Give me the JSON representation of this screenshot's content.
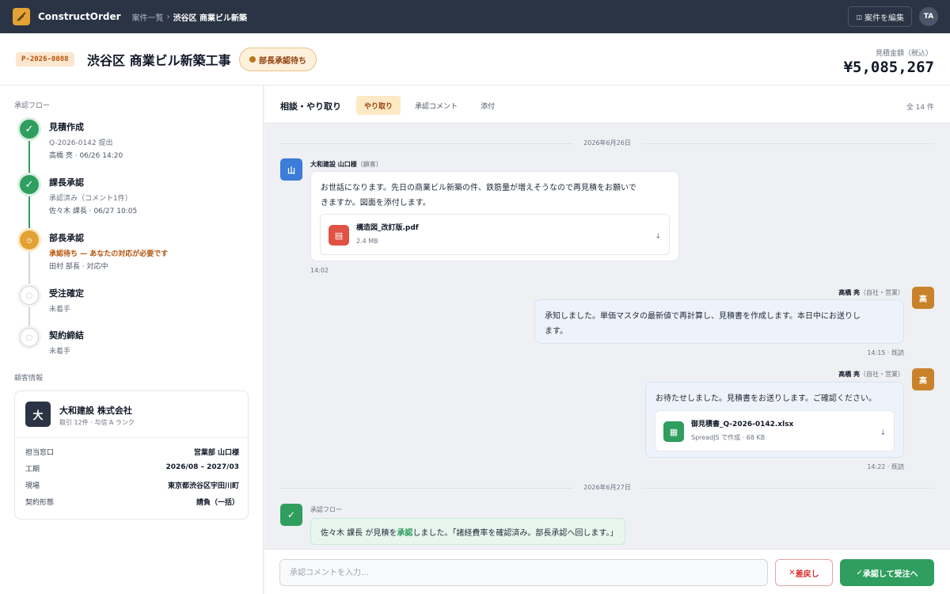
{
  "topbar": {
    "app_title": "ConstructOrder",
    "breadcrumb_parent": "案件一覧",
    "breadcrumb_sep": "›",
    "breadcrumb_current": "渋谷区 商業ビル新築",
    "edit_label": "案件を編集",
    "user_initials": "TA"
  },
  "header": {
    "project_id": "P-2026-0088",
    "title": "渋谷区 商業ビル新築工事",
    "status": "部長承認待ち",
    "estimate_label": "見積金額（税込）",
    "estimate_value": "¥5,085,267"
  },
  "flow": {
    "section_title": "承認フロー",
    "steps": [
      {
        "name": "見積作成",
        "sub": "Q-2026-0142 提出",
        "meta": "高橋 亮 · 06/26 14:20",
        "state": "done"
      },
      {
        "name": "課長承認",
        "sub": "承認済み（コメント1件）",
        "meta": "佐々木 課長 · 06/27 10:05",
        "state": "done"
      },
      {
        "name": "部長承認",
        "sub": "承認待ち — あなたの対応が必要です",
        "meta": "田村 部長 · 対応中",
        "state": "current"
      },
      {
        "name": "受注確定",
        "sub": "未着手",
        "state": "todo"
      },
      {
        "name": "契約締結",
        "sub": "未着手",
        "state": "todo"
      }
    ]
  },
  "customer": {
    "section_title": "顧客情報",
    "initial": "大",
    "name": "大和建設 株式会社",
    "sub": "取引 12件 · 与信 A ランク",
    "rows": [
      {
        "k": "担当窓口",
        "v": "営業部 山口様"
      },
      {
        "k": "工期",
        "v": "2026/08 – 2027/03"
      },
      {
        "k": "現場",
        "v": "東京都渋谷区宇田川町"
      },
      {
        "k": "契約形態",
        "v": "請負（一括）"
      }
    ]
  },
  "main": {
    "title": "相談・やり取り",
    "tabs": [
      "やり取り",
      "承認コメント",
      "添付"
    ],
    "count": "全 14 件"
  },
  "messages": {
    "date1": "2026年6月26日",
    "m1": {
      "avatar": "山",
      "sender": "大和建設 山口様",
      "role": "（顧客）",
      "line1": "お世話になります。先日の商業ビル新築の件、鉄筋量が増えそうなので再見積をお願いで",
      "line2": "きますか。図面を添付します。",
      "file_name": "構造図_改訂版.pdf",
      "file_size": "2.4 MB",
      "time": "14:02"
    },
    "m2": {
      "avatar": "高",
      "sender": "高橋 亮",
      "role": "（自社・営業）",
      "line1": "承知しました。単価マスタの最新値で再計算し、見積書を作成します。本日中にお送りし",
      "line2": "ます。",
      "time": "14:15 · 既読"
    },
    "m3": {
      "avatar": "高",
      "sender": "高橋 亮",
      "role": "（自社・営業）",
      "line1": "お待たせしました。見積書をお送りします。ご確認ください。",
      "file_name": "御見積書_Q-2026-0142.xlsx",
      "file_size": "SpreadJS で作成 · 68 KB",
      "time": "14:22 · 既読"
    },
    "date2": "2026年6月27日",
    "flow_label": "承認フロー",
    "flow_pre": "佐々木 課長 が見積を",
    "flow_hl": "承認",
    "flow_post": "しました。「諸経費率を確認済み。部長承認へ回します。」"
  },
  "footer": {
    "placeholder": "承認コメントを入力…",
    "reject_label": "差戻し",
    "approve_label": "承認して受注へ"
  },
  "colors": {
    "topbar": "#2b3444",
    "accent": "#e3a233",
    "success": "#2f9e5f",
    "danger": "#dc2626"
  }
}
